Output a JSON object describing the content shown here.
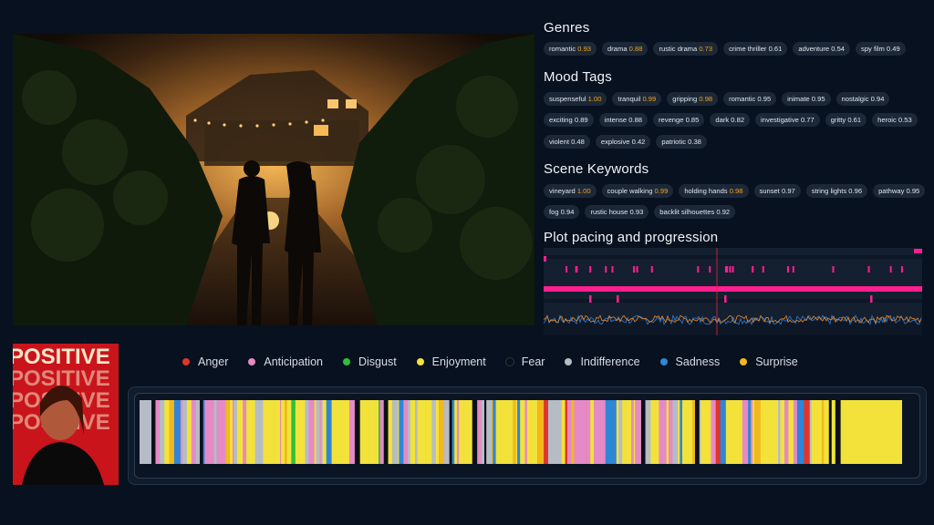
{
  "genres": {
    "title": "Genres",
    "tags": [
      {
        "label": "romantic",
        "score": "0.93",
        "highlight": true
      },
      {
        "label": "drama",
        "score": "0.88",
        "highlight": true
      },
      {
        "label": "rustic drama",
        "score": "0.73",
        "highlight": true
      },
      {
        "label": "crime thriller",
        "score": "0.61",
        "highlight": false
      },
      {
        "label": "adventure",
        "score": "0.54",
        "highlight": false
      },
      {
        "label": "spy film",
        "score": "0.49",
        "highlight": false
      }
    ]
  },
  "mood": {
    "title": "Mood Tags",
    "rows": [
      [
        {
          "label": "suspenseful",
          "score": "1.00",
          "highlight": true
        },
        {
          "label": "tranquil",
          "score": "0.99",
          "highlight": true
        },
        {
          "label": "gripping",
          "score": "0.98",
          "highlight": true
        },
        {
          "label": "romantic",
          "score": "0.95",
          "highlight": false
        },
        {
          "label": "inimate",
          "score": "0.95",
          "highlight": false
        },
        {
          "label": "nostalgic",
          "score": "0.94",
          "highlight": false
        }
      ],
      [
        {
          "label": "exciting",
          "score": "0.89",
          "highlight": false
        },
        {
          "label": "intense",
          "score": "0.88",
          "highlight": false
        },
        {
          "label": "revenge",
          "score": "0.85",
          "highlight": false
        },
        {
          "label": "dark",
          "score": "0.82",
          "highlight": false
        },
        {
          "label": "investigative",
          "score": "0.77",
          "highlight": false
        },
        {
          "label": "gritty",
          "score": "0.61",
          "highlight": false
        },
        {
          "label": "heroic",
          "score": "0.53",
          "highlight": false
        }
      ],
      [
        {
          "label": "violent",
          "score": "0.48",
          "highlight": false
        },
        {
          "label": "explosive",
          "score": "0.42",
          "highlight": false
        },
        {
          "label": "patriotic",
          "score": "0.38",
          "highlight": false
        }
      ]
    ]
  },
  "keywords": {
    "title": "Scene Keywords",
    "rows": [
      [
        {
          "label": "vineyard",
          "score": "1.00",
          "highlight": true
        },
        {
          "label": "couple walking",
          "score": "0.99",
          "highlight": true
        },
        {
          "label": "holding hands",
          "score": "0.98",
          "highlight": true
        },
        {
          "label": "sunset",
          "score": "0.97",
          "highlight": false
        },
        {
          "label": "string lights",
          "score": "0.96",
          "highlight": false
        },
        {
          "label": "pathway",
          "score": "0.95",
          "highlight": false
        }
      ],
      [
        {
          "label": "fog",
          "score": "0.94",
          "highlight": false
        },
        {
          "label": "rustic house",
          "score": "0.93",
          "highlight": false
        },
        {
          "label": "backlit silhouettes",
          "score": "0.92",
          "highlight": false
        }
      ]
    ]
  },
  "pacing": {
    "title": "Plot pacing and progression",
    "colors": {
      "accent": "#ff1f8f",
      "playhead": "#e0263a",
      "line_a": "#e98a2a",
      "line_b": "#2f7fd3"
    }
  },
  "thumbnail": {
    "logo_text": "POSITIVE",
    "icon": "portrait-thumbnail"
  },
  "legend": [
    {
      "label": "Anger",
      "color": "#e0352b"
    },
    {
      "label": "Anticipation",
      "color": "#e58ac4"
    },
    {
      "label": "Disgust",
      "color": "#2fbf3a"
    },
    {
      "label": "Enjoyment",
      "color": "#f2e23a"
    },
    {
      "label": "Fear",
      "color": "#0a0f18"
    },
    {
      "label": "Indifference",
      "color": "#b5bcc6"
    },
    {
      "label": "Sadness",
      "color": "#2f86d6"
    },
    {
      "label": "Surprise",
      "color": "#f2b81c"
    }
  ]
}
